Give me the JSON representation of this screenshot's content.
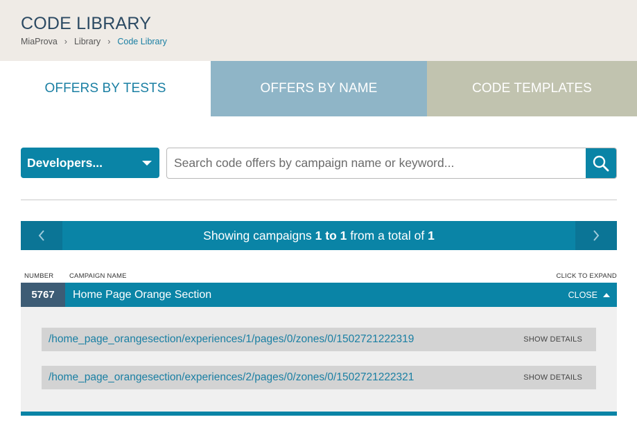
{
  "header": {
    "title": "CODE LIBRARY",
    "breadcrumb": [
      "MiaProva",
      "Library",
      "Code Library"
    ],
    "separator": "›"
  },
  "tabs": [
    {
      "label": "OFFERS BY TESTS",
      "active": true
    },
    {
      "label": "OFFERS BY NAME",
      "active": false
    },
    {
      "label": "CODE TEMPLATES",
      "active": false
    }
  ],
  "filter": {
    "dropdown_value": "Developers...",
    "search_placeholder": "Search code offers by campaign name or keyword..."
  },
  "pager": {
    "prefix": "Showing campaigns",
    "range": "1 to 1",
    "middle": "from a total of",
    "total": "1"
  },
  "table": {
    "col_number": "NUMBER",
    "col_name": "CAMPAIGN NAME",
    "col_expand": "CLICK TO EXPAND"
  },
  "campaigns": [
    {
      "number": "5767",
      "name": "Home Page Orange Section",
      "toggle_label": "CLOSE",
      "offers": [
        {
          "path": "/home_page_orangesection/experiences/1/pages/0/zones/0/1502721222319",
          "action": "SHOW DETAILS"
        },
        {
          "path": "/home_page_orangesection/experiences/2/pages/0/zones/0/1502721222321",
          "action": "SHOW DETAILS"
        }
      ]
    }
  ],
  "colors": {
    "accent": "#0a84a6",
    "number_bg": "#3d5c75",
    "header_bg": "#efebe6",
    "tab_name_bg": "#8fb5c7",
    "tab_templates_bg": "#c1c3af",
    "link": "#1a7fa3"
  },
  "icons": {
    "search": "search-icon",
    "prev": "chevron-left-icon",
    "next": "chevron-right-icon",
    "dropdown": "caret-down-icon",
    "collapse": "caret-up-icon"
  }
}
